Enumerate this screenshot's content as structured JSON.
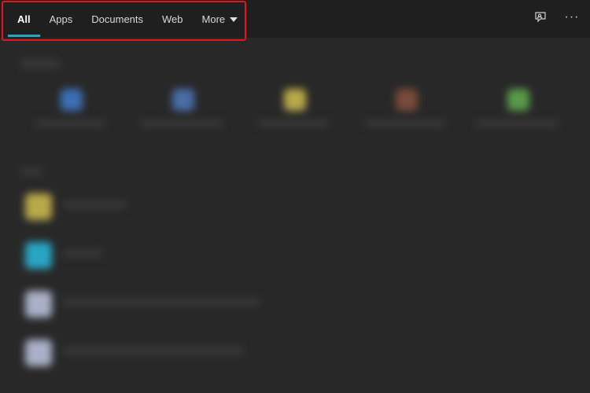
{
  "tabs": [
    {
      "label": "All",
      "active": true
    },
    {
      "label": "Apps",
      "active": false
    },
    {
      "label": "Documents",
      "active": false
    },
    {
      "label": "Web",
      "active": false
    },
    {
      "label": "More",
      "active": false,
      "has_caret": true
    }
  ],
  "actions": {
    "feedback_icon": "feedback-icon",
    "more_options_icon": "more-options-icon",
    "more_options_glyph": "···"
  },
  "colors": {
    "accent": "#2aa6c5",
    "highlight": "#e8141b",
    "background": "#282828",
    "topbar": "#1f1f1f"
  },
  "blurred_top_apps": [
    {
      "color": "#3c6fb4"
    },
    {
      "color": "#4a6ea8"
    },
    {
      "color": "#b9a94a"
    },
    {
      "color": "#7a4b3a"
    },
    {
      "color": "#5a9a4a"
    }
  ],
  "blurred_list_items": [
    {
      "color": "#b9a94a"
    },
    {
      "color": "#2aa6c5"
    },
    {
      "color": "#aab0c8"
    },
    {
      "color": "#aab0c8"
    }
  ]
}
